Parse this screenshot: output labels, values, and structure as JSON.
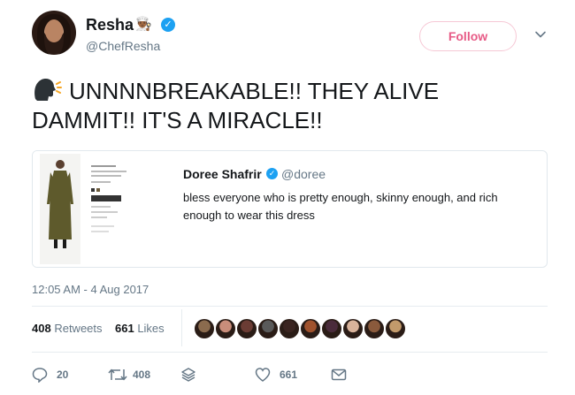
{
  "author": {
    "name": "Resha",
    "name_emoji": "👨🏾‍🍳",
    "verified_mark": "✓",
    "handle": "@ChefResha"
  },
  "follow_label": "Follow",
  "tweet_text": "UNNNNBREAKABLE!! THEY ALIVE DAMMIT!! IT'S A MIRACLE!!",
  "tweet_icon": "speaking-head-icon",
  "quoted_tweet": {
    "name": "Doree Shafrir",
    "verified_mark": "✓",
    "handle": "@doree",
    "text": "bless everyone who is pretty enough, skinny enough, and rich enough to wear this dress"
  },
  "timestamp": "12:05 AM - 4 Aug 2017",
  "stats": {
    "retweets_count": "408",
    "retweets_label": "Retweets",
    "likes_count": "661",
    "likes_label": "Likes"
  },
  "likers_colors": [
    "#8b6b4e",
    "#c98d7a",
    "#6b3c34",
    "#5a5a5a",
    "#3a2420",
    "#a0522d",
    "#4a2b3b",
    "#d9b39b",
    "#8a5a3c",
    "#c29a6b"
  ],
  "actions": {
    "reply_count": "20",
    "retweet_count": "408",
    "like_count": "661"
  },
  "colors": {
    "link_blue": "#1da1f2",
    "follow_pink": "#e0245e",
    "muted": "#657786"
  }
}
